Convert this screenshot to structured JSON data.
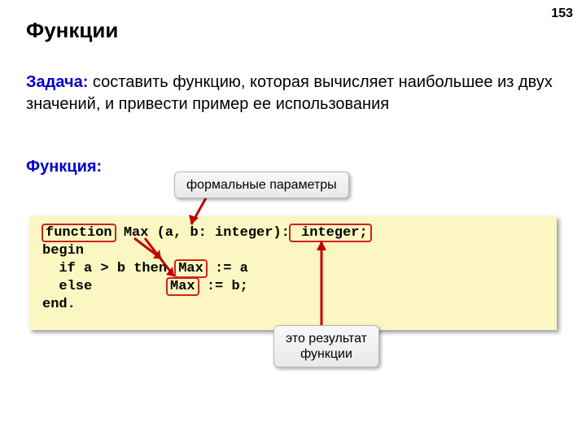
{
  "page_number": "153",
  "title": "Функции",
  "task_label": "Задача:",
  "task_text": " составить функцию, которая вычисляет наибольшее из двух значений, и привести пример ее использования",
  "fn_label": "Функция:",
  "callout_top": "формальные параметры",
  "callout_bottom_l1": "это результат",
  "callout_bottom_l2": "функции",
  "code": {
    "kw_function": "function",
    "sig_mid": " Max (a, b: integer):",
    "ret_type": " integer;",
    "l_begin": "begin",
    "l_if_a": "  if a > b then ",
    "max1": "Max",
    "l_if_b": " := a",
    "l_else_a": "  else         ",
    "max2": "Max",
    "l_else_b": " := b;",
    "l_end": "end."
  }
}
